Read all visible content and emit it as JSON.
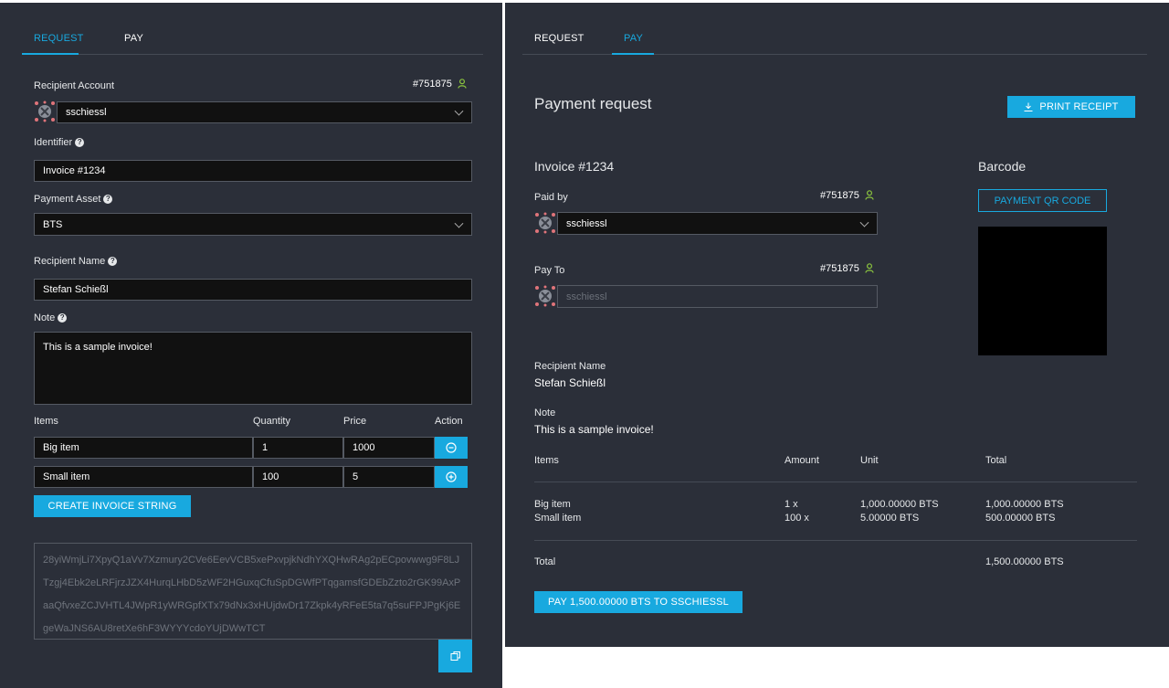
{
  "request": {
    "tabs": [
      {
        "label": "REQUEST",
        "active": true
      },
      {
        "label": "PAY",
        "active": false
      }
    ],
    "recipient_account_label": "Recipient Account",
    "account_id": "#751875",
    "account_name": "sschiessl",
    "identifier_label": "Identifier",
    "identifier_value": "Invoice #1234",
    "payment_asset_label": "Payment Asset",
    "payment_asset_value": "BTS",
    "recipient_name_label": "Recipient Name",
    "recipient_name_value": "Stefan Schießl",
    "note_label": "Note",
    "note_value": "This is a sample invoice!",
    "items_headers": {
      "items": "Items",
      "quantity": "Quantity",
      "price": "Price",
      "action": "Action"
    },
    "items": [
      {
        "name": "Big item",
        "quantity": "1",
        "price": "1000",
        "action": "remove-circle-icon"
      },
      {
        "name": "Small item",
        "quantity": "100",
        "price": "5",
        "action": "add-circle-icon"
      }
    ],
    "create_button": "CREATE INVOICE STRING",
    "invoice_string": "28yiWmjLi7XpyQ1aVv7Xzmury2CVe6EevVCB5xePxvpjkNdhYXQHwRAg2pECpovwwg9F8LJTzgj4Ebk2eLRFjrzJZX4HurqLHbD5zWF2HGuxqCfuSpDGWfPTqgamsfGDEbZzto2rGK99AxPaaQfvxeZCJVHTL4JWpR1yWRGpfXTx79dNx3xHUjdwDr17Zkpk4yRFeE5ta7q5suFPJPgKj6EgeWaJNS6AU8retXe6hF3WYYYcdoYUjDWwTCT"
  },
  "pay": {
    "tabs": [
      {
        "label": "REQUEST",
        "active": false
      },
      {
        "label": "PAY",
        "active": true
      }
    ],
    "title": "Payment request",
    "print_button": "PRINT RECEIPT",
    "invoice_title": "Invoice #1234",
    "barcode_label": "Barcode",
    "qr_button": "PAYMENT QR CODE",
    "paid_by_label": "Paid by",
    "paid_by_id": "#751875",
    "paid_by_name": "sschiessl",
    "pay_to_label": "Pay To",
    "pay_to_id": "#751875",
    "pay_to_name": "sschiessl",
    "recipient_name_label": "Recipient Name",
    "recipient_name_value": "Stefan Schießl",
    "note_label": "Note",
    "note_value": "This is a sample invoice!",
    "table_headers": {
      "items": "Items",
      "amount": "Amount",
      "unit": "Unit",
      "total": "Total"
    },
    "rows": [
      {
        "item": "Big item",
        "amount": "1 x",
        "unit": "1,000.00000 BTS",
        "total": "1,000.00000 BTS"
      },
      {
        "item": "Small item",
        "amount": "100 x",
        "unit": "5.00000 BTS",
        "total": "500.00000 BTS"
      }
    ],
    "total_label": "Total",
    "total_value": "1,500.00000 BTS",
    "pay_button": "PAY 1,500.00000 BTS TO SSCHIESSL"
  },
  "colors": {
    "accent": "#18a9df",
    "panel": "#2b2f39",
    "input": "#111111",
    "person_icon": "#8cc63f"
  }
}
